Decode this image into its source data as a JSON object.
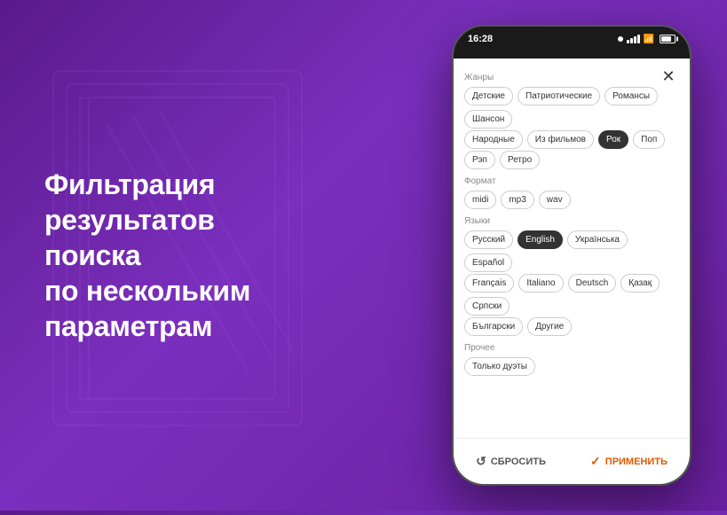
{
  "background": {
    "gradient_start": "#5a1a8a",
    "gradient_end": "#7b2fbe"
  },
  "left": {
    "title_line1": "Фильтрация",
    "title_line2": "результатов поиска",
    "title_line3": "по нескольким",
    "title_line4": "параметрам"
  },
  "phone": {
    "status_bar": {
      "time": "16:28"
    },
    "close_button": "✕",
    "sections": [
      {
        "id": "genres",
        "label": "Жанры",
        "tags": [
          {
            "text": "Детские",
            "active": false
          },
          {
            "text": "Патриотические",
            "active": false
          },
          {
            "text": "Романсы",
            "active": false
          },
          {
            "text": "Шансон",
            "active": false
          },
          {
            "text": "Народные",
            "active": false
          },
          {
            "text": "Из фильмов",
            "active": false
          },
          {
            "text": "Рок",
            "active": true
          },
          {
            "text": "Поп",
            "active": false
          },
          {
            "text": "Рэп",
            "active": false
          },
          {
            "text": "Ретро",
            "active": false
          }
        ]
      },
      {
        "id": "format",
        "label": "Формат",
        "tags": [
          {
            "text": "midi",
            "active": false
          },
          {
            "text": "mp3",
            "active": false
          },
          {
            "text": "wav",
            "active": false
          }
        ]
      },
      {
        "id": "languages",
        "label": "Языки",
        "tags": [
          {
            "text": "Русский",
            "active": false
          },
          {
            "text": "English",
            "active": true
          },
          {
            "text": "Українська",
            "active": false
          },
          {
            "text": "Español",
            "active": false
          },
          {
            "text": "Français",
            "active": false
          },
          {
            "text": "Italiano",
            "active": false
          },
          {
            "text": "Deutsch",
            "active": false
          },
          {
            "text": "Қазақ",
            "active": false
          },
          {
            "text": "Српски",
            "active": false
          },
          {
            "text": "Български",
            "active": false
          },
          {
            "text": "Другие",
            "active": false
          }
        ]
      },
      {
        "id": "other",
        "label": "Прочее",
        "tags": [
          {
            "text": "Только дуэты",
            "active": false
          }
        ]
      }
    ],
    "bottom": {
      "reset_label": "СБРОСИТЬ",
      "apply_label": "ПРИМЕНИТЬ"
    }
  }
}
